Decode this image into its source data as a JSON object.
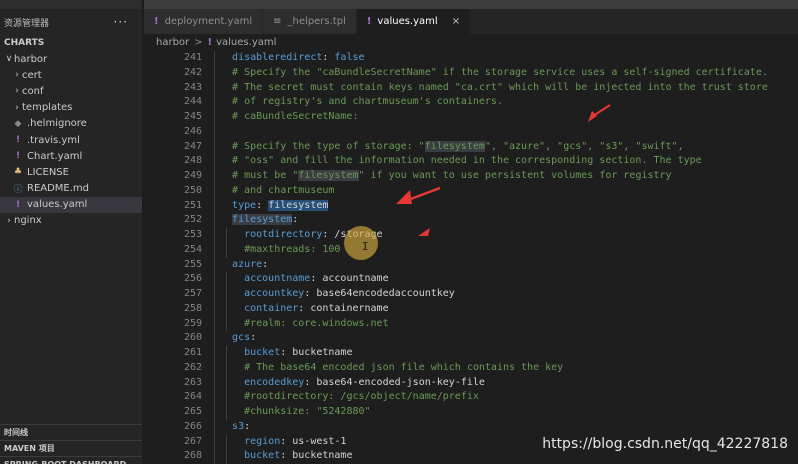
{
  "explorer": {
    "title": "资源管理器",
    "more": "···",
    "section": "CHARTS",
    "tree": [
      {
        "label": "harbor",
        "kind": "folder-open",
        "indent": 0
      },
      {
        "label": "cert",
        "kind": "folder",
        "indent": 1
      },
      {
        "label": "conf",
        "kind": "folder",
        "indent": 1
      },
      {
        "label": "templates",
        "kind": "folder",
        "indent": 1
      },
      {
        "label": ".helmignore",
        "kind": "ignore",
        "indent": 1
      },
      {
        "label": ".travis.yml",
        "kind": "yaml",
        "indent": 1
      },
      {
        "label": "Chart.yaml",
        "kind": "yaml",
        "indent": 1
      },
      {
        "label": "LICENSE",
        "kind": "license",
        "indent": 1
      },
      {
        "label": "README.md",
        "kind": "info",
        "indent": 1
      },
      {
        "label": "values.yaml",
        "kind": "yaml",
        "indent": 1,
        "selected": true
      },
      {
        "label": "nginx",
        "kind": "folder",
        "indent": 0
      }
    ],
    "bottom_sections": [
      "时间线",
      "MAVEN 项目",
      "SPRING-BOOT DASHBOARD"
    ]
  },
  "tabs": [
    {
      "label": "deployment.yaml",
      "icon": "yaml"
    },
    {
      "label": "_helpers.tpl",
      "icon": "tpl"
    },
    {
      "label": "values.yaml",
      "icon": "yaml",
      "active": true,
      "close": "×"
    }
  ],
  "breadcrumb": {
    "folder": "harbor",
    "sep": ">",
    "file": "values.yaml"
  },
  "editor": {
    "lines": [
      {
        "n": "241",
        "ind": 1,
        "t": [
          [
            "k",
            "disableredirect"
          ],
          [
            "p",
            ": "
          ],
          [
            "k",
            "false"
          ]
        ]
      },
      {
        "n": "242",
        "ind": 1,
        "t": [
          [
            "c",
            "# Specify the \"caBundleSecretName\" if the storage service uses a self-signed certificate."
          ]
        ]
      },
      {
        "n": "243",
        "ind": 1,
        "t": [
          [
            "c",
            "# The secret must contain keys named \"ca.crt\" which will be injected into the trust store"
          ]
        ]
      },
      {
        "n": "244",
        "ind": 1,
        "t": [
          [
            "c",
            "# of registry's and chartmuseum's containers."
          ]
        ]
      },
      {
        "n": "245",
        "ind": 1,
        "t": [
          [
            "c",
            "# caBundleSecretName:"
          ]
        ]
      },
      {
        "n": "246",
        "ind": 1,
        "t": []
      },
      {
        "n": "247",
        "ind": 1,
        "t": [
          [
            "c",
            "# Specify the type of storage: \""
          ],
          [
            "cm",
            "filesystem"
          ],
          [
            "c",
            "\", \"azure\", \"gcs\", \"s3\", \"swift\","
          ]
        ]
      },
      {
        "n": "248",
        "ind": 1,
        "t": [
          [
            "c",
            "# \"oss\" and fill the information needed in the corresponding section. The type"
          ]
        ]
      },
      {
        "n": "249",
        "ind": 1,
        "t": [
          [
            "c",
            "# must be \""
          ],
          [
            "cm",
            "filesystem"
          ],
          [
            "c",
            "\" if you want to use persistent volumes for registry"
          ]
        ]
      },
      {
        "n": "250",
        "ind": 1,
        "t": [
          [
            "c",
            "# and chartmuseum"
          ]
        ]
      },
      {
        "n": "251",
        "ind": 1,
        "t": [
          [
            "k",
            "type"
          ],
          [
            "p",
            ": "
          ],
          [
            "ps",
            "filesystem"
          ]
        ]
      },
      {
        "n": "252",
        "ind": 1,
        "t": [
          [
            "ks",
            "filesystem"
          ],
          [
            "p",
            ":"
          ]
        ]
      },
      {
        "n": "253",
        "ind": 2,
        "t": [
          [
            "k",
            "rootdirectory"
          ],
          [
            "p",
            ": /storage"
          ]
        ]
      },
      {
        "n": "254",
        "ind": 2,
        "t": [
          [
            "c",
            "#maxthreads: 100"
          ]
        ]
      },
      {
        "n": "255",
        "ind": 1,
        "t": [
          [
            "k",
            "azure"
          ],
          [
            "p",
            ":"
          ]
        ]
      },
      {
        "n": "256",
        "ind": 2,
        "t": [
          [
            "k",
            "accountname"
          ],
          [
            "p",
            ": accountname"
          ]
        ]
      },
      {
        "n": "257",
        "ind": 2,
        "t": [
          [
            "k",
            "accountkey"
          ],
          [
            "p",
            ": base64encodedaccountkey"
          ]
        ]
      },
      {
        "n": "258",
        "ind": 2,
        "t": [
          [
            "k",
            "container"
          ],
          [
            "p",
            ": containername"
          ]
        ]
      },
      {
        "n": "259",
        "ind": 2,
        "t": [
          [
            "c",
            "#realm: core.windows.net"
          ]
        ]
      },
      {
        "n": "260",
        "ind": 1,
        "t": [
          [
            "k",
            "gcs"
          ],
          [
            "p",
            ":"
          ]
        ]
      },
      {
        "n": "261",
        "ind": 2,
        "t": [
          [
            "k",
            "bucket"
          ],
          [
            "p",
            ": bucketname"
          ]
        ]
      },
      {
        "n": "262",
        "ind": 2,
        "t": [
          [
            "c",
            "# The base64 encoded json file which contains the key"
          ]
        ]
      },
      {
        "n": "263",
        "ind": 2,
        "t": [
          [
            "k",
            "encodedkey"
          ],
          [
            "p",
            ": base64-encoded-json-key-file"
          ]
        ]
      },
      {
        "n": "264",
        "ind": 2,
        "t": [
          [
            "c",
            "#rootdirectory: /gcs/object/name/prefix"
          ]
        ]
      },
      {
        "n": "265",
        "ind": 2,
        "t": [
          [
            "c",
            "#chunksize: \"5242880\""
          ]
        ]
      },
      {
        "n": "266",
        "ind": 1,
        "t": [
          [
            "k",
            "s3"
          ],
          [
            "p",
            ":"
          ]
        ]
      },
      {
        "n": "267",
        "ind": 2,
        "t": [
          [
            "k",
            "region"
          ],
          [
            "p",
            ": us-west-1"
          ]
        ]
      },
      {
        "n": "268",
        "ind": 2,
        "t": [
          [
            "k",
            "bucket"
          ],
          [
            "p",
            ": bucketname"
          ]
        ]
      }
    ]
  },
  "watermark": "https://blog.csdn.net/qq_42227818"
}
